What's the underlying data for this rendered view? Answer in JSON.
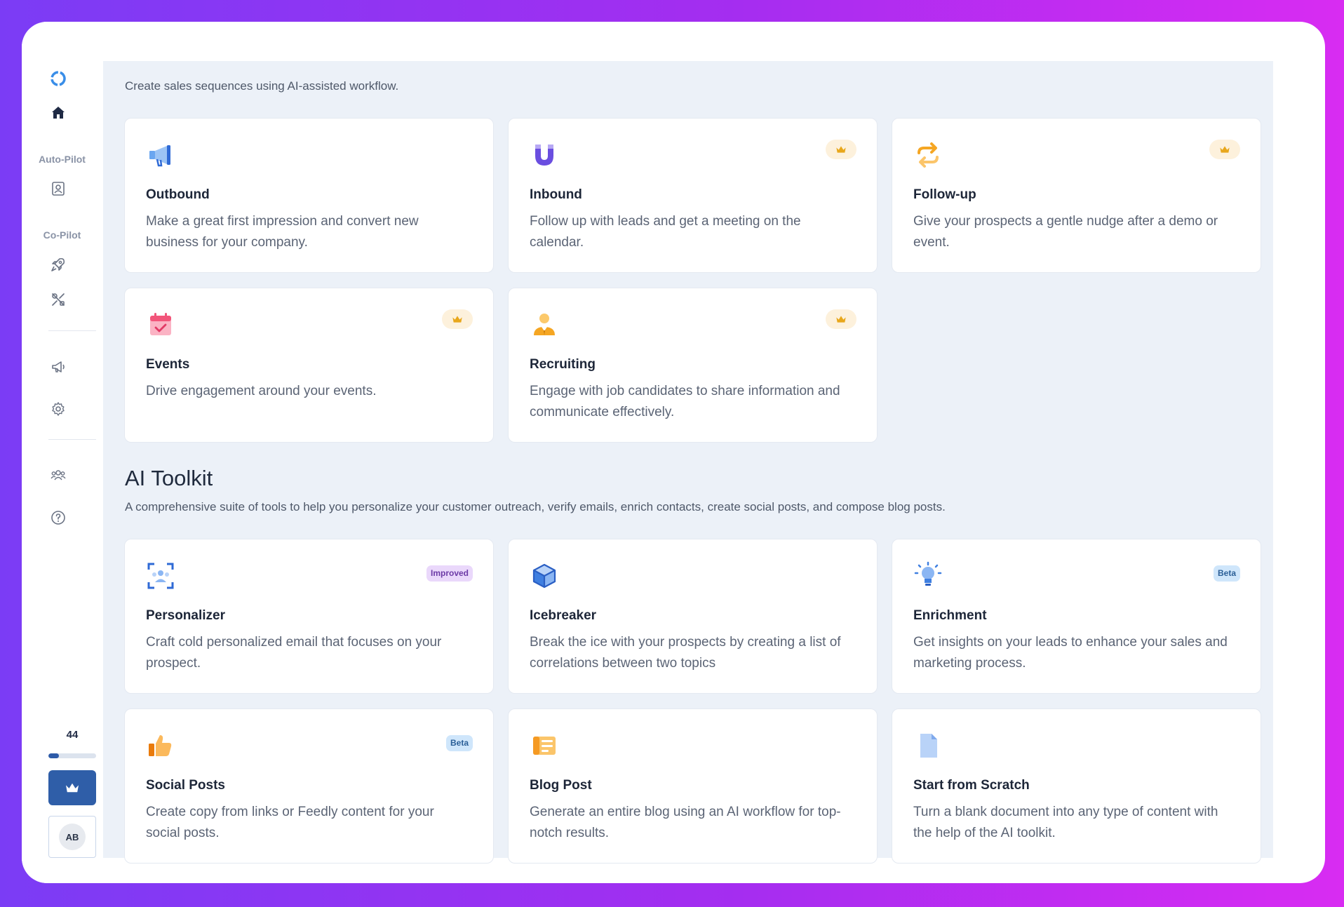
{
  "sidebar": {
    "auto_pilot_label": "Auto-Pilot",
    "co_pilot_label": "Co-Pilot",
    "credits": "44",
    "credits_used_fraction": 0.22,
    "avatar_initials": "AB"
  },
  "sequences": {
    "subtitle": "Create sales sequences using AI-assisted workflow."
  },
  "sequence_cards": [
    {
      "title": "Outbound",
      "description": "Make a great first impression and convert new business for your company.",
      "icon": "megaphone-icon",
      "premium": false
    },
    {
      "title": "Inbound",
      "description": "Follow up with leads and get a meeting on the calendar.",
      "icon": "magnet-icon",
      "premium": true
    },
    {
      "title": "Follow-up",
      "description": "Give your prospects a gentle nudge after a demo or event.",
      "icon": "repeat-arrows-icon",
      "premium": true
    },
    {
      "title": "Events",
      "description": "Drive engagement around your events.",
      "icon": "calendar-icon",
      "premium": true
    },
    {
      "title": "Recruiting",
      "description": "Engage with job candidates to share information and communicate effectively.",
      "icon": "recruiter-icon",
      "premium": true
    }
  ],
  "toolkit": {
    "title": "AI Toolkit",
    "subtitle": "A comprehensive suite of tools to help you personalize your customer outreach, verify emails, enrich contacts, create social posts, and compose blog posts."
  },
  "toolkit_cards": [
    {
      "title": "Personalizer",
      "description": "Craft cold personalized email that focuses on your prospect.",
      "icon": "face-scan-icon",
      "badge": "Improved"
    },
    {
      "title": "Icebreaker",
      "description": "Break the ice with your prospects by creating a list of correlations between two topics",
      "icon": "cube-icon",
      "badge": ""
    },
    {
      "title": "Enrichment",
      "description": "Get insights on your leads to enhance your sales and marketing process.",
      "icon": "lightbulb-icon",
      "badge": "Beta"
    },
    {
      "title": "Social Posts",
      "description": "Create copy from links or Feedly content for your social posts.",
      "icon": "thumbs-up-icon",
      "badge": "Beta"
    },
    {
      "title": "Blog Post",
      "description": "Generate an entire blog using an AI workflow for top-notch results.",
      "icon": "blog-icon",
      "badge": ""
    },
    {
      "title": "Start from Scratch",
      "description": "Turn a blank document into any type of content with the help of the AI toolkit.",
      "icon": "document-icon",
      "badge": ""
    }
  ],
  "colors": {
    "accent": "#2f5ea8",
    "background": "#ecf1f8",
    "frame_gradient_start": "#7b3cf5",
    "frame_gradient_end": "#d82cf2"
  }
}
